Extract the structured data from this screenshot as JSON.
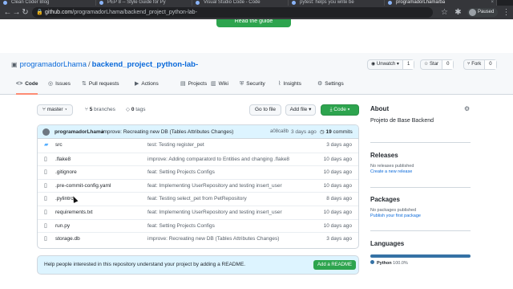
{
  "browser": {
    "tabs": [
      {
        "title": "Clean Coder Blog"
      },
      {
        "title": "PEP 8 -- Style Guide for Py"
      },
      {
        "title": "Visual Studio Code - Code"
      },
      {
        "title": "pytest: helps you write be"
      },
      {
        "title": "programadorLhama/ba"
      }
    ],
    "url_host": "github.com",
    "url_path": "/programadorLhama/backend_project_python-lab-",
    "profile_status": "Paused"
  },
  "banner": {
    "guide_button": "Read the guide"
  },
  "repo": {
    "owner": "programadorLhama",
    "separator": "/",
    "name": "backend_project_python-lab-",
    "unwatch_label": "Unwatch",
    "watch_count": "1",
    "star_label": "Star",
    "star_count": "0",
    "fork_label": "Fork",
    "fork_count": "0"
  },
  "nav": [
    {
      "label": "Code",
      "icon": "code-icon"
    },
    {
      "label": "Issues",
      "icon": "issue-icon"
    },
    {
      "label": "Pull requests",
      "icon": "pull-request-icon"
    },
    {
      "label": "Actions",
      "icon": "actions-icon"
    },
    {
      "label": "Projects",
      "icon": "projects-icon"
    },
    {
      "label": "Wiki",
      "icon": "wiki-icon"
    },
    {
      "label": "Security",
      "icon": "shield-icon"
    },
    {
      "label": "Insights",
      "icon": "graph-icon"
    },
    {
      "label": "Settings",
      "icon": "gear-icon"
    }
  ],
  "toolbar": {
    "branch": "master",
    "branches_count": "5",
    "branches_label": "branches",
    "tags_count": "0",
    "tags_label": "tags",
    "go_to_file": "Go to file",
    "add_file": "Add file",
    "code": "Code"
  },
  "latest_commit": {
    "author": "programadorLhama",
    "message": "improve: Recreating new DB (Tables Attributes Changes)",
    "sha": "a08ca8b",
    "age": "3 days ago",
    "count": "19",
    "count_label": "commits"
  },
  "files": [
    {
      "name": "src",
      "type": "dir",
      "message": "test: Testing register_pet",
      "age": "3 days ago"
    },
    {
      "name": ".flake8",
      "type": "file",
      "message": "improve: Adding comparatord to Entities and changing .flake8",
      "age": "10 days ago"
    },
    {
      "name": ".gitignore",
      "type": "file",
      "message": "feat: Setting Projects Configs",
      "age": "10 days ago"
    },
    {
      "name": ".pre-commit-config.yaml",
      "type": "file",
      "message": "feat: Implementing UserRepository and testing insert_user",
      "age": "10 days ago"
    },
    {
      "name": ".pylintrc",
      "type": "file",
      "message": "feat: Testing select_pet from PetRepository",
      "age": "8 days ago"
    },
    {
      "name": "requirements.txt",
      "type": "file",
      "message": "feat: Implementing UserRepository and testing insert_user",
      "age": "10 days ago"
    },
    {
      "name": "run.py",
      "type": "file",
      "message": "feat: Setting Projects Configs",
      "age": "10 days ago"
    },
    {
      "name": "storage.db",
      "type": "file",
      "message": "improve: Recreating new DB (Tables Attributes Changes)",
      "age": "3 days ago"
    }
  ],
  "readme_prompt": {
    "text": "Help people interested in this repository understand your project by adding a README.",
    "button": "Add a README"
  },
  "sidebar": {
    "about_title": "About",
    "description": "Projeto de Base Backend",
    "releases_title": "Releases",
    "releases_none": "No releases published",
    "releases_link": "Create a new release",
    "packages_title": "Packages",
    "packages_none": "No packages published",
    "packages_link": "Publish your first package",
    "languages_title": "Languages",
    "language_name": "Python",
    "language_pct": "100.0%"
  },
  "colors": {
    "accent_green": "#2da44e",
    "link_blue": "#0969da",
    "python": "#3572a5",
    "nav_underline": "#fd8c73"
  }
}
